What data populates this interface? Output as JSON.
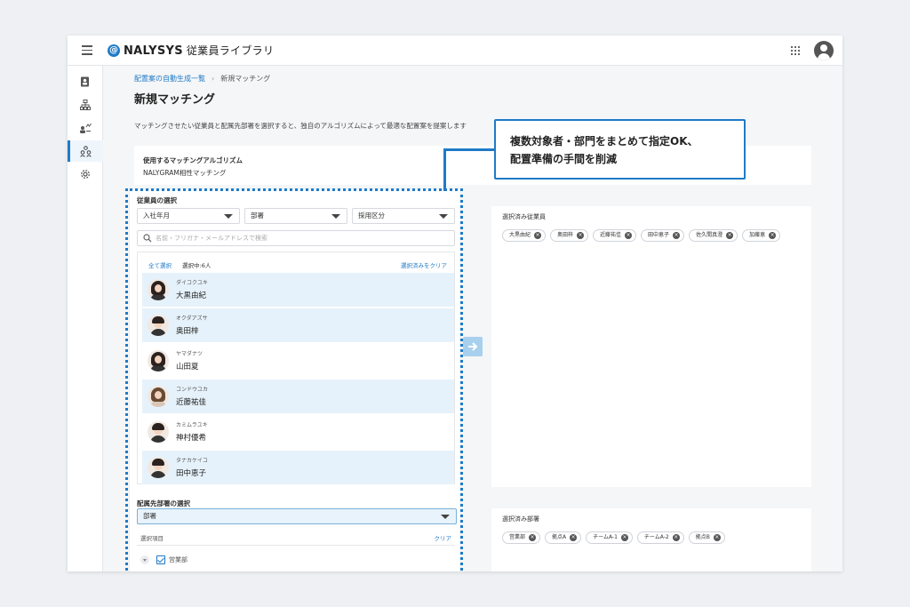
{
  "app": {
    "logo_mark": "@",
    "brand": "NALYSYS",
    "product": "従業員ライブラリ"
  },
  "breadcrumb": {
    "parent": "配置案の自動生成一覧",
    "separator": "›",
    "current": "新規マッチング"
  },
  "page": {
    "title": "新規マッチング",
    "description": "マッチングさせたい従業員と配属先部署を選択すると、独自のアルゴリズムによって最適な配置案を提案します"
  },
  "algorithm": {
    "label": "使用するマッチングアルゴリズム",
    "value": "NALYGRAM相性マッチング"
  },
  "employee_selection": {
    "title": "従業員の選択",
    "filters": [
      "入社年月",
      "部署",
      "採用区分"
    ],
    "search_placeholder": "名前・フリガナ・メールアドレスで検索",
    "select_all": "全て選択",
    "selected_count": "選択中:6人",
    "clear_selected": "選択済みをクリア",
    "employees": [
      {
        "kana": "ダイコクユキ",
        "name": "大黒由紀",
        "selected": true
      },
      {
        "kana": "オクダアズサ",
        "name": "奥田梓",
        "selected": true
      },
      {
        "kana": "ヤマダナツ",
        "name": "山田夏",
        "selected": false
      },
      {
        "kana": "コンドウユカ",
        "name": "近藤祐佳",
        "selected": true
      },
      {
        "kana": "カミムラユキ",
        "name": "神村優希",
        "selected": false
      },
      {
        "kana": "タナカケイコ",
        "name": "田中恵子",
        "selected": true
      }
    ]
  },
  "department_selection": {
    "title": "配属先部署の選択",
    "dropdown": "部署",
    "selected_items_label": "選択項目",
    "clear": "クリア",
    "tree": [
      {
        "label": "営業部",
        "checked": true
      }
    ]
  },
  "selected_employees": {
    "title": "選択済み従業員",
    "chips": [
      "大黒由紀",
      "奥田梓",
      "近藤祐佳",
      "田中恵子",
      "佐久間真澄",
      "加藤恵"
    ]
  },
  "selected_departments": {
    "title": "選択済み部署",
    "chips": [
      "営業部",
      "拠点A",
      "チームA-1",
      "チームA-2",
      "拠点B"
    ]
  },
  "callout": {
    "line1": "複数対象者・部門をまとめて指定OK、",
    "line2": "配置準備の手間を削減"
  },
  "colors": {
    "accent": "#1f7ac7",
    "selected_row": "#e6f2fb",
    "arrow_button": "#a8d0ee"
  }
}
